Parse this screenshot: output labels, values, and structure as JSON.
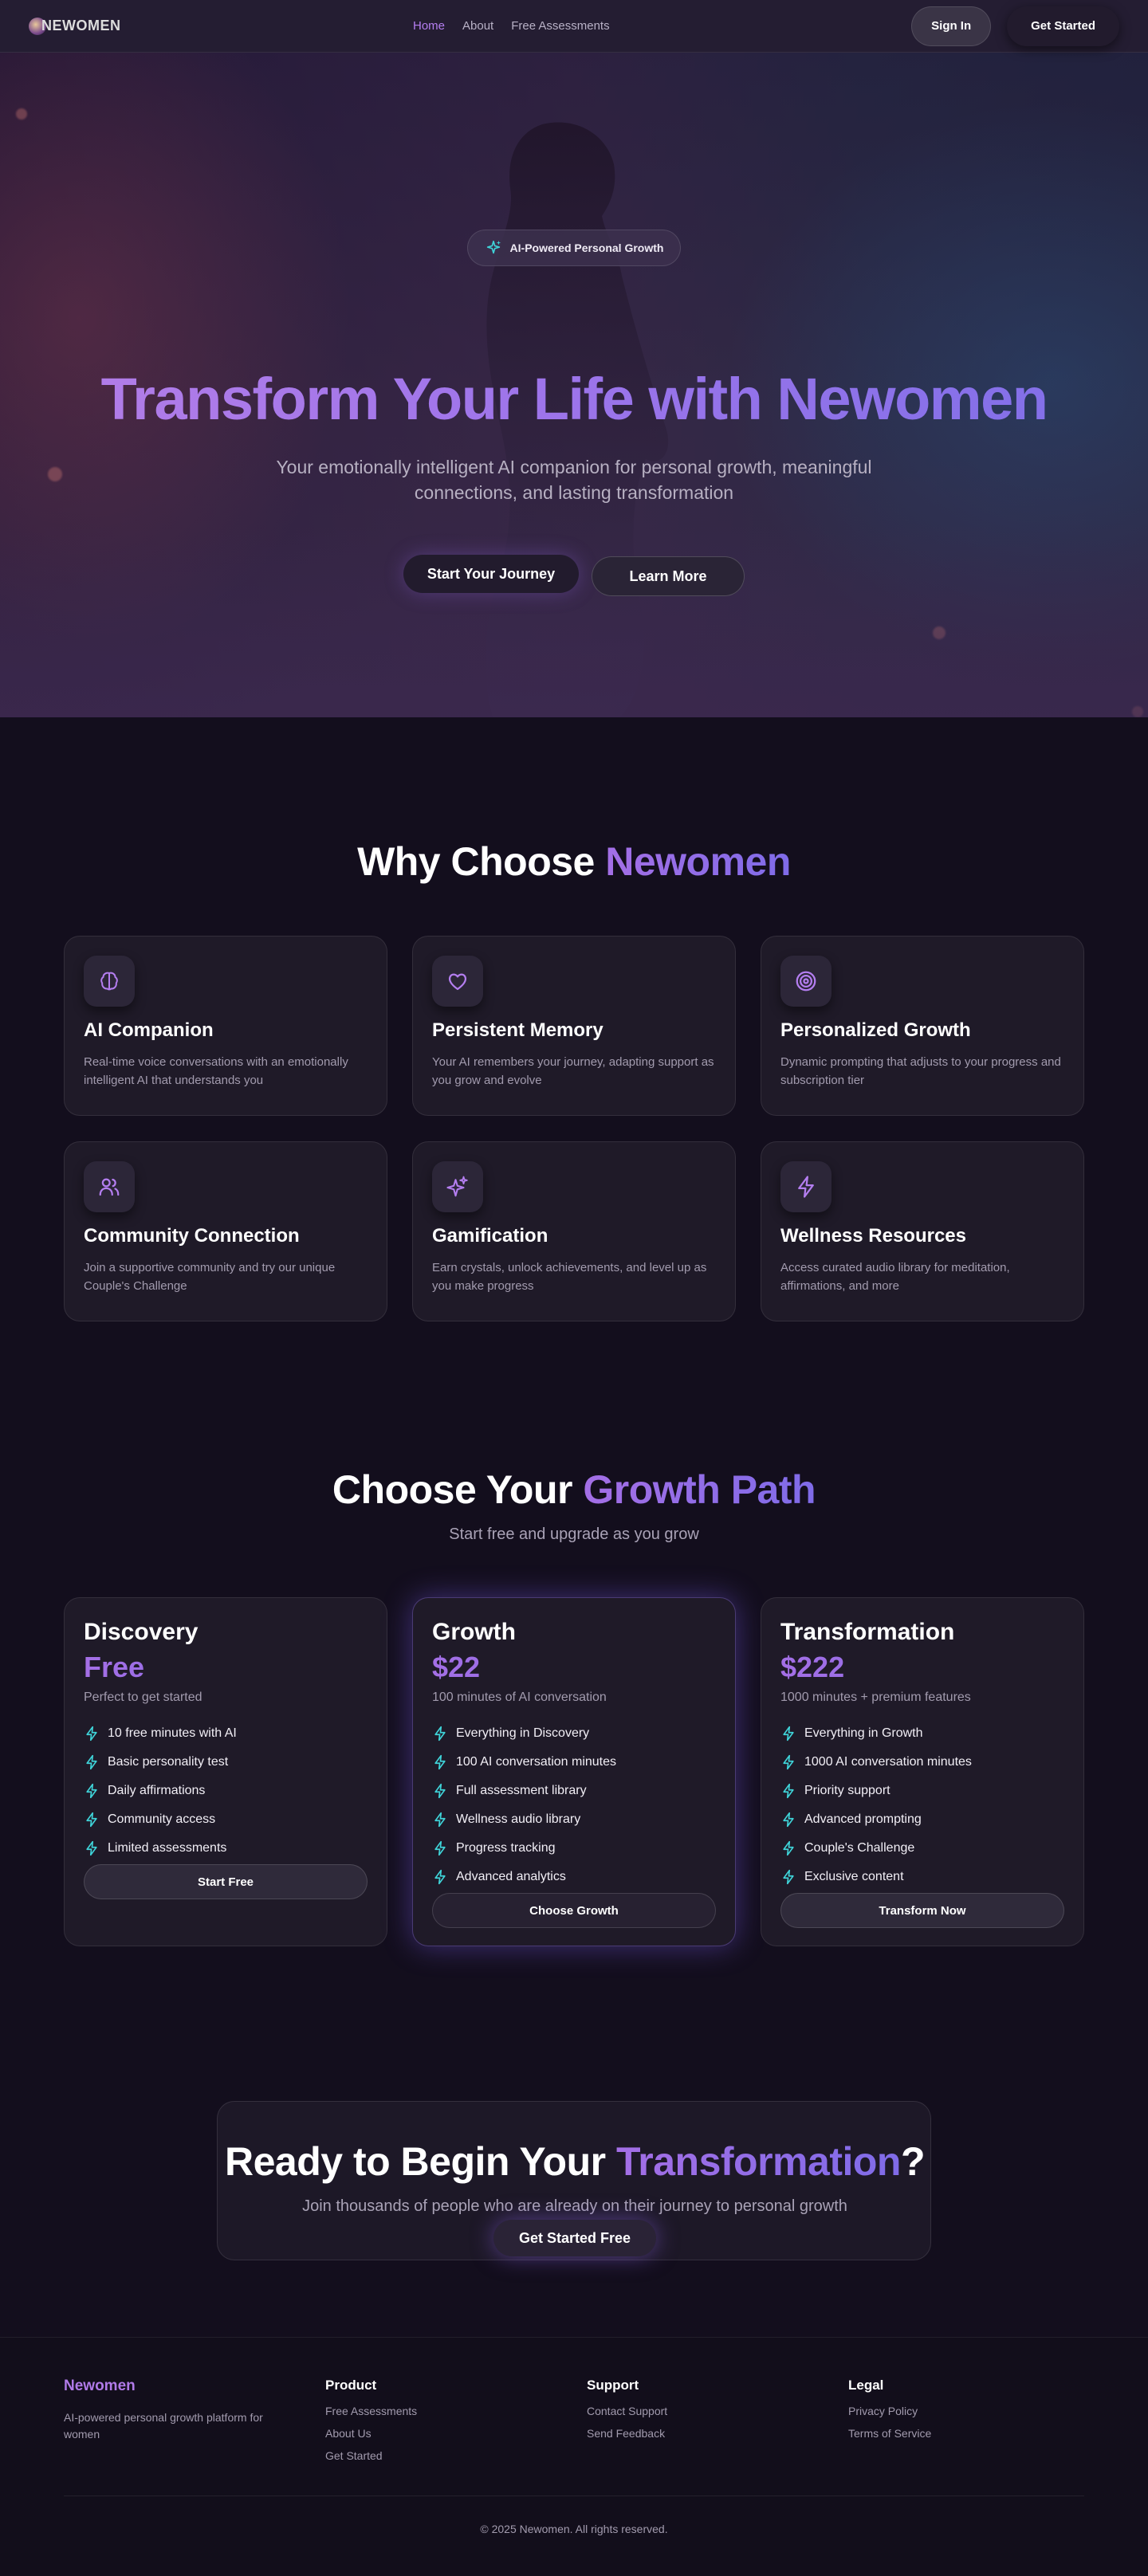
{
  "nav": {
    "logo_text": "NEWOMEN",
    "links": [
      {
        "label": "Home",
        "active": true
      },
      {
        "label": "About",
        "active": false
      },
      {
        "label": "Free Assessments",
        "active": false
      }
    ],
    "signin_label": "Sign In",
    "get_started_label": "Get Started"
  },
  "hero": {
    "badge_label": "AI-Powered Personal Growth",
    "title": "Transform Your Life with Newomen",
    "subtitle": "Your emotionally intelligent AI companion for personal growth, meaningful connections, and lasting transformation",
    "primary_button": "Start Your Journey",
    "secondary_button": "Learn More"
  },
  "features": {
    "title_plain": "Why Choose ",
    "title_accent": "Newomen",
    "items": [
      {
        "icon": "brain-icon",
        "title": "AI Companion",
        "desc": "Real-time voice conversations with an emotionally intelligent AI that understands you"
      },
      {
        "icon": "heart-icon",
        "title": "Persistent Memory",
        "desc": "Your AI remembers your journey, adapting support as you grow and evolve"
      },
      {
        "icon": "target-icon",
        "title": "Personalized Growth",
        "desc": "Dynamic prompting that adjusts to your progress and subscription tier"
      },
      {
        "icon": "users-icon",
        "title": "Community Connection",
        "desc": "Join a supportive community and try our unique Couple's Challenge"
      },
      {
        "icon": "sparkles-icon",
        "title": "Gamification",
        "desc": "Earn crystals, unlock achievements, and level up as you make progress"
      },
      {
        "icon": "lightning-icon",
        "title": "Wellness Resources",
        "desc": "Access curated audio library for meditation, affirmations, and more"
      }
    ]
  },
  "pricing": {
    "title_plain": "Choose Your ",
    "title_accent": "Growth Path",
    "subtitle": "Start free and upgrade as you grow",
    "plans": [
      {
        "name": "Discovery",
        "price": "Free",
        "desc": "Perfect to get started",
        "features": [
          "10 free minutes with AI",
          "Basic personality test",
          "Daily affirmations",
          "Community access",
          "Limited assessments"
        ],
        "button": "Start Free",
        "featured": false
      },
      {
        "name": "Growth",
        "price": "$22",
        "desc": "100 minutes of AI conversation",
        "features": [
          "Everything in Discovery",
          "100 AI conversation minutes",
          "Full assessment library",
          "Wellness audio library",
          "Progress tracking",
          "Advanced analytics"
        ],
        "button": "Choose Growth",
        "featured": true
      },
      {
        "name": "Transformation",
        "price": "$222",
        "desc": "1000 minutes + premium features",
        "features": [
          "Everything in Growth",
          "1000 AI conversation minutes",
          "Priority support",
          "Advanced prompting",
          "Couple's Challenge",
          "Exclusive content"
        ],
        "button": "Transform Now",
        "featured": false
      }
    ]
  },
  "cta": {
    "title_plain": "Ready to Begin Your ",
    "title_accent": "Transformation",
    "title_end": "?",
    "subtitle": "Join thousands of people who are already on their journey to personal growth",
    "button": "Get Started Free"
  },
  "footer": {
    "brand": "Newomen",
    "tagline": "AI-powered personal growth platform for women",
    "columns": [
      {
        "title": "Product",
        "links": [
          "Free Assessments",
          "About Us",
          "Get Started"
        ]
      },
      {
        "title": "Support",
        "links": [
          "Contact Support",
          "Send Feedback"
        ]
      },
      {
        "title": "Legal",
        "links": [
          "Privacy Policy",
          "Terms of Service"
        ]
      }
    ],
    "copyright": "© 2025 Newomen. All rights reserved."
  },
  "colors": {
    "accent_purple": "#b47ef0",
    "gradient_end": "#7f6be8",
    "check_teal": "#3fd3d8",
    "background": "#130e1d",
    "card": "#1f1a28"
  }
}
